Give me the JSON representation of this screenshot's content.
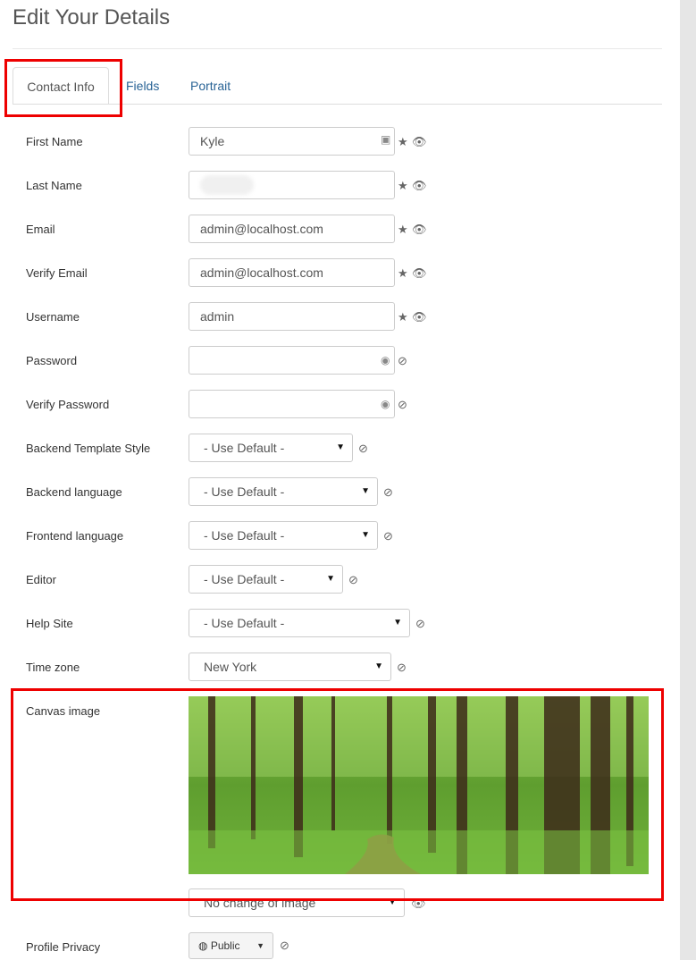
{
  "page": {
    "title": "Edit Your Details"
  },
  "tabs": [
    {
      "label": "Contact Info",
      "active": true
    },
    {
      "label": "Fields",
      "active": false
    },
    {
      "label": "Portrait",
      "active": false
    }
  ],
  "form": {
    "first_name": {
      "label": "First Name",
      "value": "Kyle"
    },
    "last_name": {
      "label": "Last Name",
      "value": ""
    },
    "email": {
      "label": "Email",
      "value": "admin@localhost.com"
    },
    "verify_email": {
      "label": "Verify Email",
      "value": "admin@localhost.com"
    },
    "username": {
      "label": "Username",
      "value": "admin"
    },
    "password": {
      "label": "Password",
      "value": ""
    },
    "verify_password": {
      "label": "Verify Password",
      "value": ""
    },
    "backend_template_style": {
      "label": "Backend Template Style",
      "value": "- Use Default -"
    },
    "backend_language": {
      "label": "Backend language",
      "value": "- Use Default -"
    },
    "frontend_language": {
      "label": "Frontend language",
      "value": "- Use Default -"
    },
    "editor": {
      "label": "Editor",
      "value": "- Use Default -"
    },
    "help_site": {
      "label": "Help Site",
      "value": "- Use Default -"
    },
    "time_zone": {
      "label": "Time zone",
      "value": "New York"
    },
    "canvas_image": {
      "label": "Canvas image",
      "select_value": "No change of image"
    },
    "profile_privacy": {
      "label": "Profile Privacy",
      "value": "Public"
    }
  },
  "icons": {
    "star": "★",
    "eye": "👁",
    "eye_hidden": "⊘",
    "caret": "▼"
  },
  "colors": {
    "highlight": "#e00000",
    "link": "#2a6496"
  }
}
